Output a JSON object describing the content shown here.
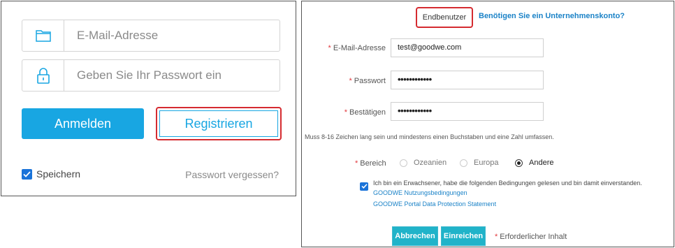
{
  "login": {
    "email_placeholder": "E-Mail-Adresse",
    "password_placeholder": "Geben Sie Ihr Passwort ein",
    "login_button": "Anmelden",
    "register_button": "Registrieren",
    "remember_label": "Speichern",
    "remember_checked": true,
    "forgot_link": "Passwort vergessen?"
  },
  "register": {
    "tab_enduser": "Endbenutzer",
    "tab_company": "Benötigen Sie ein Unternehmenskonto?",
    "required_mark": "*",
    "email_label": "E-Mail-Adresse",
    "email_value": "test@goodwe.com",
    "password_label": "Passwort",
    "password_value": "••••••••••••",
    "confirm_label": "Bestätigen",
    "confirm_value": "••••••••••••",
    "hint": "Muss 8-16 Zeichen lang sein und mindestens einen Buchstaben und eine Zahl umfassen.",
    "region_label": "Bereich",
    "regions": [
      "Ozeanien",
      "Europa",
      "Andere"
    ],
    "region_selected": "Andere",
    "agree_text": "Ich bin ein Erwachsener, habe die folgenden Bedingungen gelesen und bin damit einverstanden.",
    "terms_link_1": "GOODWE Nutzungsbedingungen",
    "terms_link_2": "GOODWE Portal Data Protection Statement",
    "cancel_button": "Abbrechen",
    "submit_button": "Einreichen",
    "required_note": "Erforderlicher Inhalt"
  },
  "colors": {
    "primary_blue": "#18a6e2",
    "highlight_red": "#d52b30",
    "teal_button": "#20b3c9",
    "link_blue": "#1a82c7"
  }
}
